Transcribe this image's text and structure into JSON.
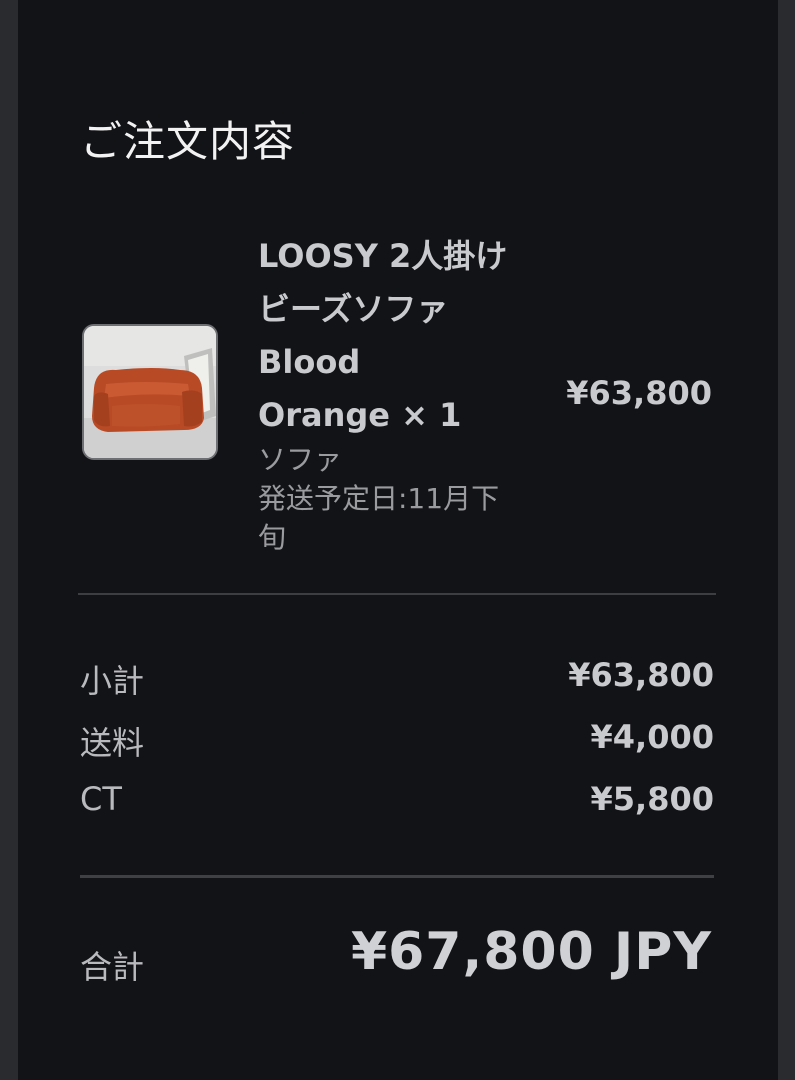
{
  "order": {
    "title": "ご注文内容",
    "item": {
      "name_lines": [
        "LOOSY 2人掛け",
        "ビーズソファ",
        "Blood",
        "Orange × 1"
      ],
      "category": "ソファ",
      "shipping_lines": [
        "発送予定日:11月下",
        "旬"
      ],
      "price": "¥63,800",
      "thumbnail_icon": "orange-sofa-photo"
    },
    "summary": [
      {
        "label": "小計",
        "value": "¥63,800"
      },
      {
        "label": "送料",
        "value": "¥4,000"
      },
      {
        "label": "CT",
        "value": "¥5,800"
      }
    ],
    "total": {
      "label": "合計",
      "value": "¥67,800 JPY"
    }
  }
}
